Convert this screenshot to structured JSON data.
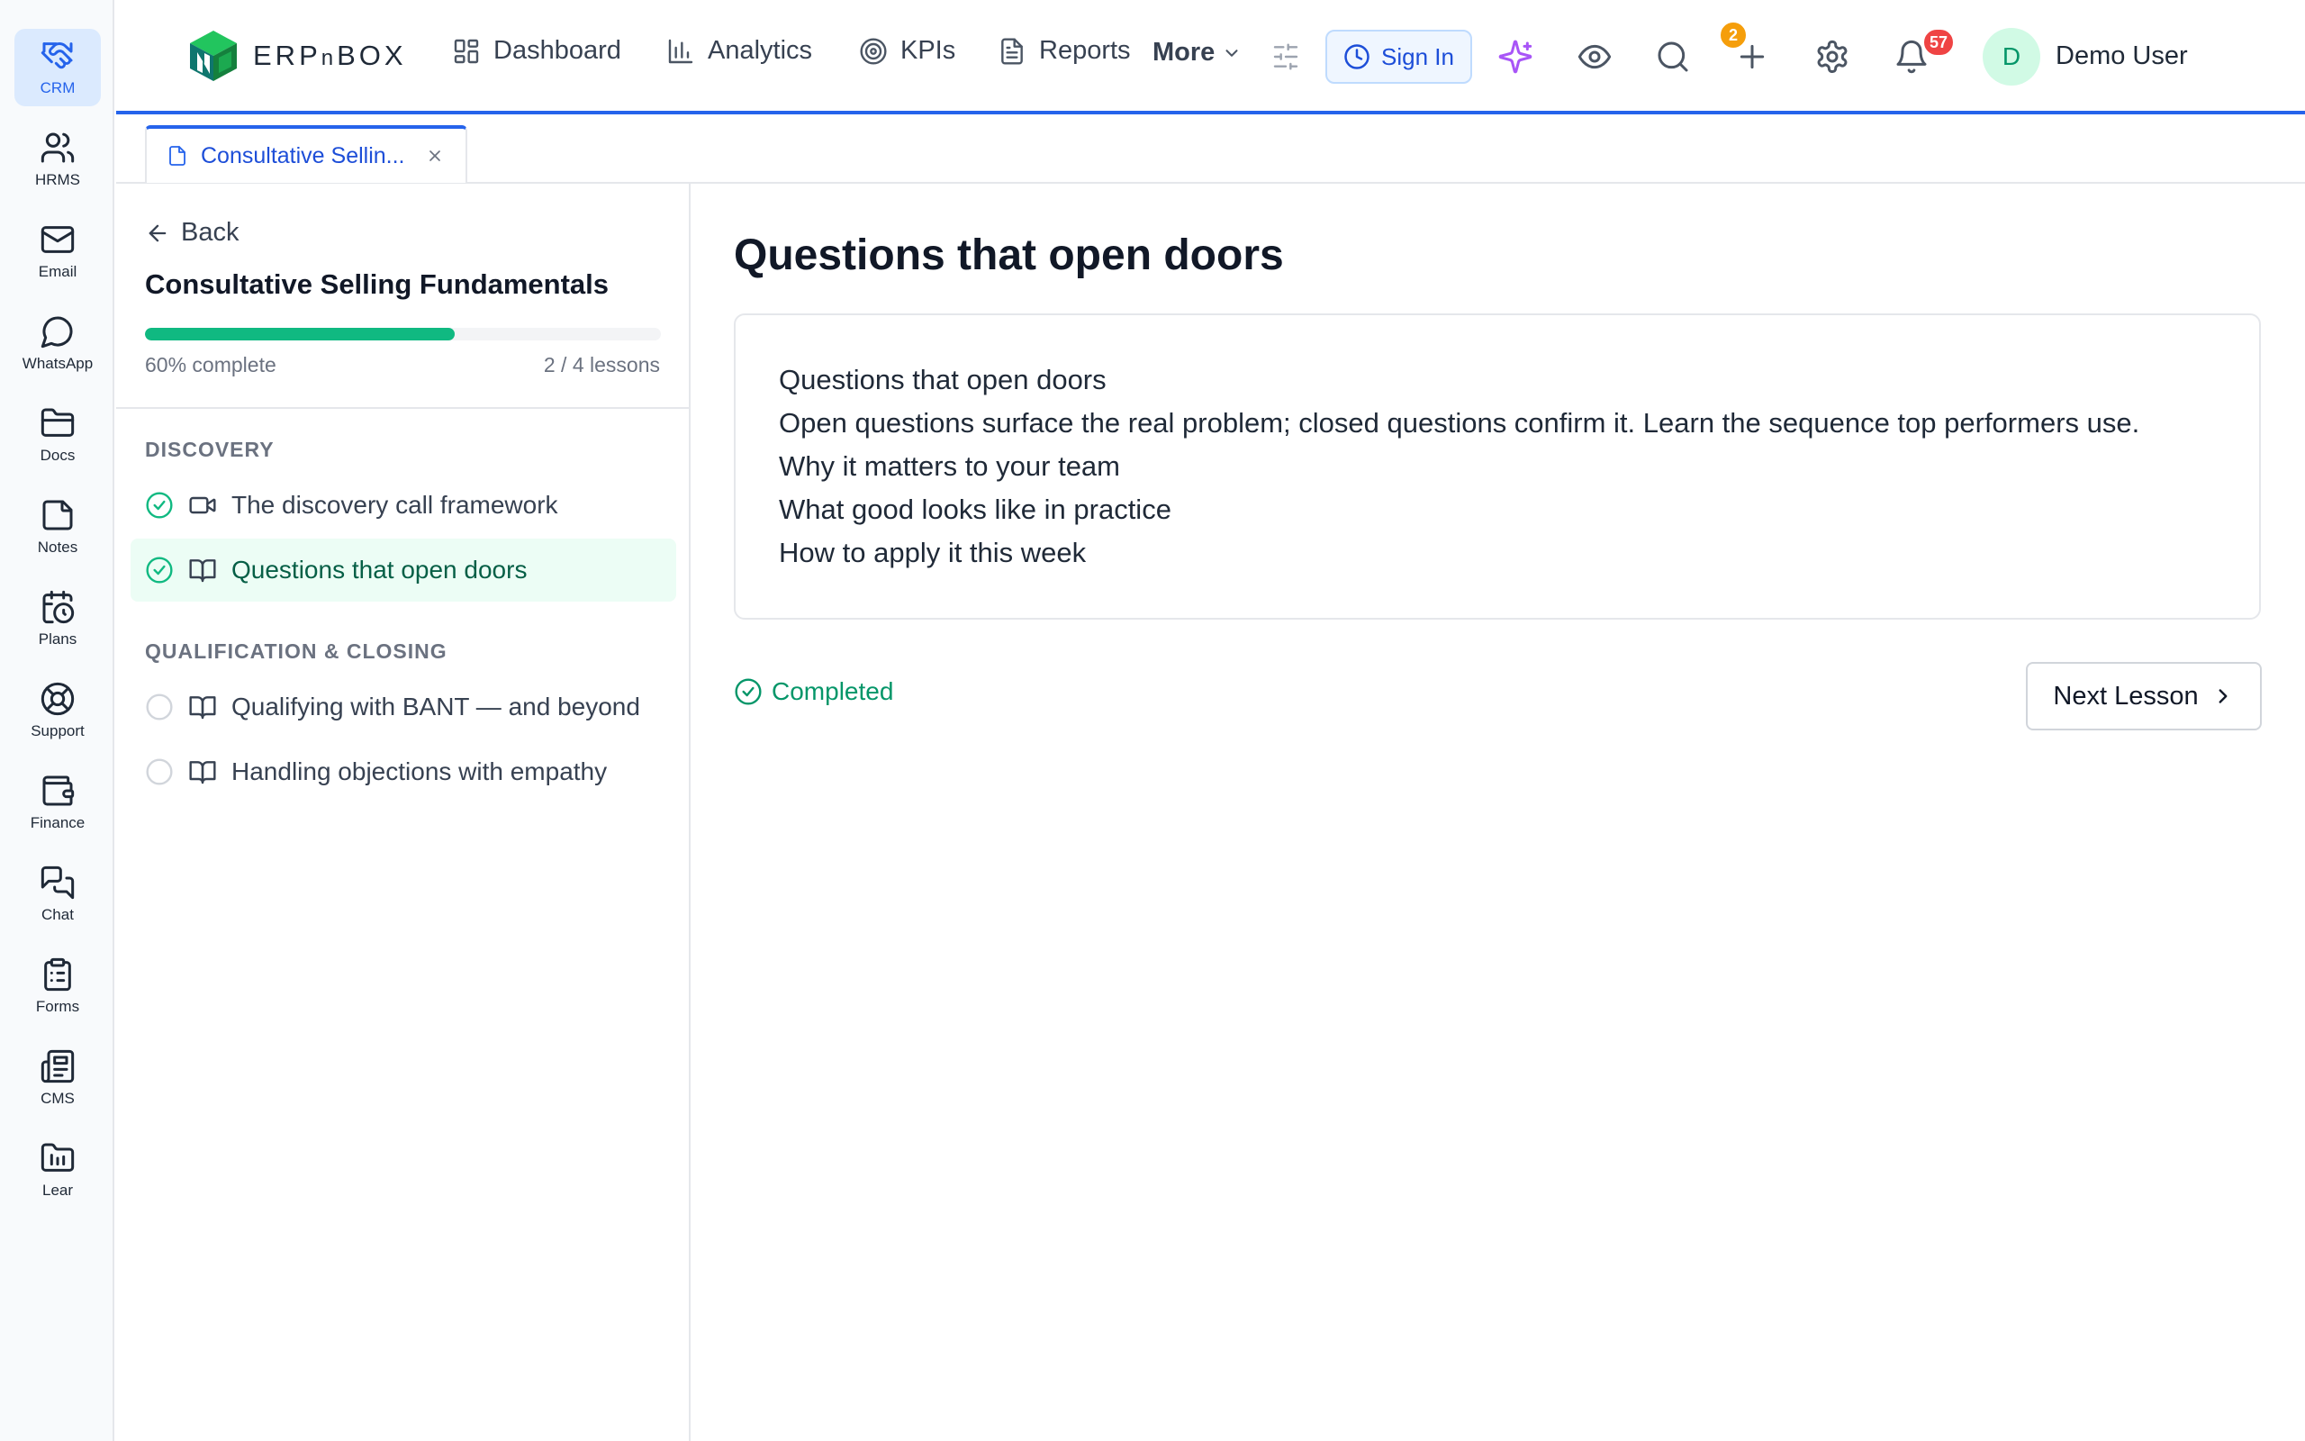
{
  "rail": {
    "items": [
      {
        "label": "CRM",
        "icon": "handshake-icon",
        "active": true
      },
      {
        "label": "HRMS",
        "icon": "users-icon"
      },
      {
        "label": "Email",
        "icon": "mail-icon"
      },
      {
        "label": "WhatsApp",
        "icon": "message-circle-icon"
      },
      {
        "label": "Docs",
        "icon": "folder-icon"
      },
      {
        "label": "Notes",
        "icon": "sticky-note-icon"
      },
      {
        "label": "Plans",
        "icon": "calendar-clock-icon"
      },
      {
        "label": "Support",
        "icon": "lifebuoy-icon"
      },
      {
        "label": "Finance",
        "icon": "wallet-icon"
      },
      {
        "label": "Chat",
        "icon": "messages-icon"
      },
      {
        "label": "Forms",
        "icon": "clipboard-list-icon"
      },
      {
        "label": "CMS",
        "icon": "newspaper-icon"
      },
      {
        "label": "Lear",
        "icon": "book-folder-icon"
      }
    ]
  },
  "header": {
    "logo_text_a": "ERP",
    "logo_text_b": "n",
    "logo_text_c": "BOX",
    "nav": {
      "dashboard": "Dashboard",
      "analytics": "Analytics",
      "kpis": "KPIs",
      "reports": "Reports",
      "more": "More"
    },
    "sign_in": "Sign In",
    "watch_count": "2",
    "notification_count": "57",
    "user_initial": "D",
    "user_name": "Demo User",
    "colors": {
      "accent": "#2563eb",
      "badge_watch": "#f59e0b",
      "badge_notify": "#ef4444",
      "ai": "#a855f7"
    }
  },
  "tab": {
    "label": "Consultative Sellin..."
  },
  "course": {
    "back_label": "Back",
    "title": "Consultative Selling Fundamentals",
    "progress_fraction": 0.6,
    "progress_text": "60% complete",
    "lessons_count_text": "2 / 4 lessons",
    "sections": [
      {
        "title": "DISCOVERY",
        "lessons": [
          {
            "label": "The discovery call framework",
            "type": "video-icon",
            "status": "completed"
          },
          {
            "label": "Questions that open doors",
            "type": "book-open-icon",
            "status": "completed",
            "current": true
          }
        ]
      },
      {
        "title": "QUALIFICATION & CLOSING",
        "lessons": [
          {
            "label": "Qualifying with BANT — and beyond",
            "type": "book-open-icon",
            "status": "pending"
          },
          {
            "label": "Handling objections with empathy",
            "type": "book-open-icon",
            "status": "pending"
          }
        ]
      }
    ]
  },
  "main": {
    "heading": "Questions that open doors",
    "content_lines": [
      "Questions that open doors",
      "Open questions surface the real problem; closed questions confirm it. Learn the sequence top performers use.",
      "Why it matters to your team",
      "What good looks like in practice",
      "How to apply it this week"
    ],
    "completed_label": "Completed",
    "next_label": "Next Lesson"
  }
}
